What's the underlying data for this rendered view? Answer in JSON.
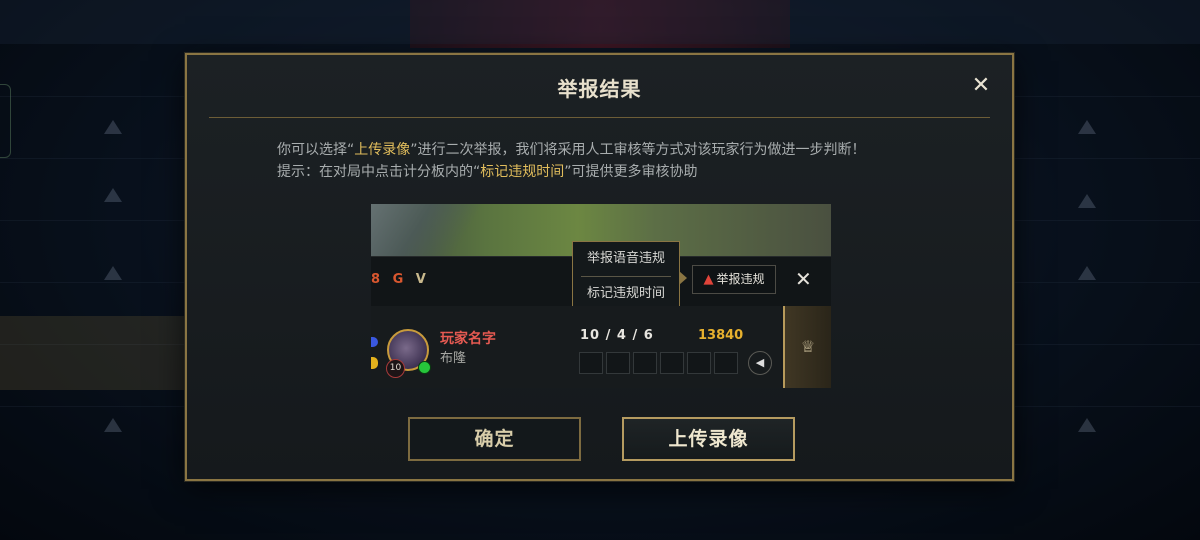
{
  "dialog": {
    "title": "举报结果",
    "close_glyph": "✕",
    "desc_line1": {
      "pre": "你可以选择“",
      "highlight": "上传录像",
      "post": "”进行二次举报，我们将采用人工审核等方式对该玩家行为做进一步判断！"
    },
    "desc_line2": {
      "pre": "提示：在对局中点击计分板内的“",
      "highlight": "标记违规时间",
      "post": "”可提供更多审核协助"
    },
    "buttons": {
      "confirm": "确定",
      "upload": "上传录像"
    }
  },
  "preview": {
    "hud_icons": {
      "left": "8 G",
      "right": "V"
    },
    "popup": {
      "item1": "举报语音违规",
      "item2": "标记违规时间"
    },
    "report_button": {
      "warn_glyph": "▲",
      "label": "举报违规"
    },
    "close_glyph": "✕",
    "player": {
      "name": "玩家名字",
      "champion": "布隆",
      "level": "10",
      "kda": "10 / 4 / 6",
      "gold": "13840"
    },
    "sound_glyph": "◀",
    "trophy_glyph": "♕"
  },
  "colors": {
    "accent_gold": "#e1bd5c",
    "border_gold": "#8a7543",
    "player_red": "#e65a52",
    "gold_value": "#e7b12e"
  }
}
